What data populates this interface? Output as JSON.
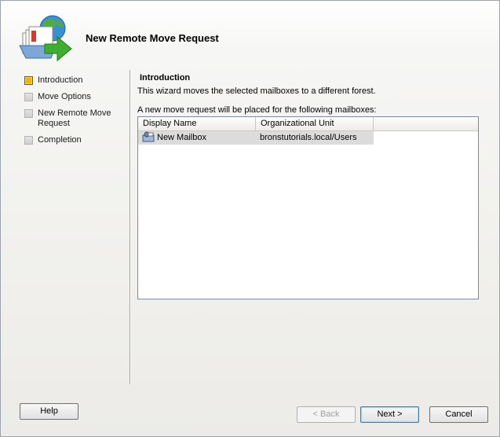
{
  "wizard": {
    "title": "New Remote Move Request",
    "icon": "move-mailbox-wizard-icon"
  },
  "steps": [
    {
      "label": "Introduction",
      "active": true
    },
    {
      "label": "Move Options",
      "active": false
    },
    {
      "label": "New Remote Move Request",
      "active": false
    },
    {
      "label": "Completion",
      "active": false
    }
  ],
  "page": {
    "title": "Introduction",
    "description": "This wizard moves the selected mailboxes to a different forest.",
    "list_caption": "A new move request will be placed for the following mailboxes:"
  },
  "grid": {
    "columns": [
      "Display Name",
      "Organizational Unit"
    ],
    "rows": [
      {
        "display_name": "New Mailbox",
        "ou": "bronstutorials.local/Users",
        "icon": "mailbox-user-icon",
        "selected": true
      }
    ]
  },
  "buttons": {
    "help": "Help",
    "back": "< Back",
    "next": "Next >",
    "cancel": "Cancel"
  },
  "colors": {
    "active_step": "#f0b400",
    "selection": "#dcdcdc",
    "default_button_border": "#3c7fb1"
  }
}
